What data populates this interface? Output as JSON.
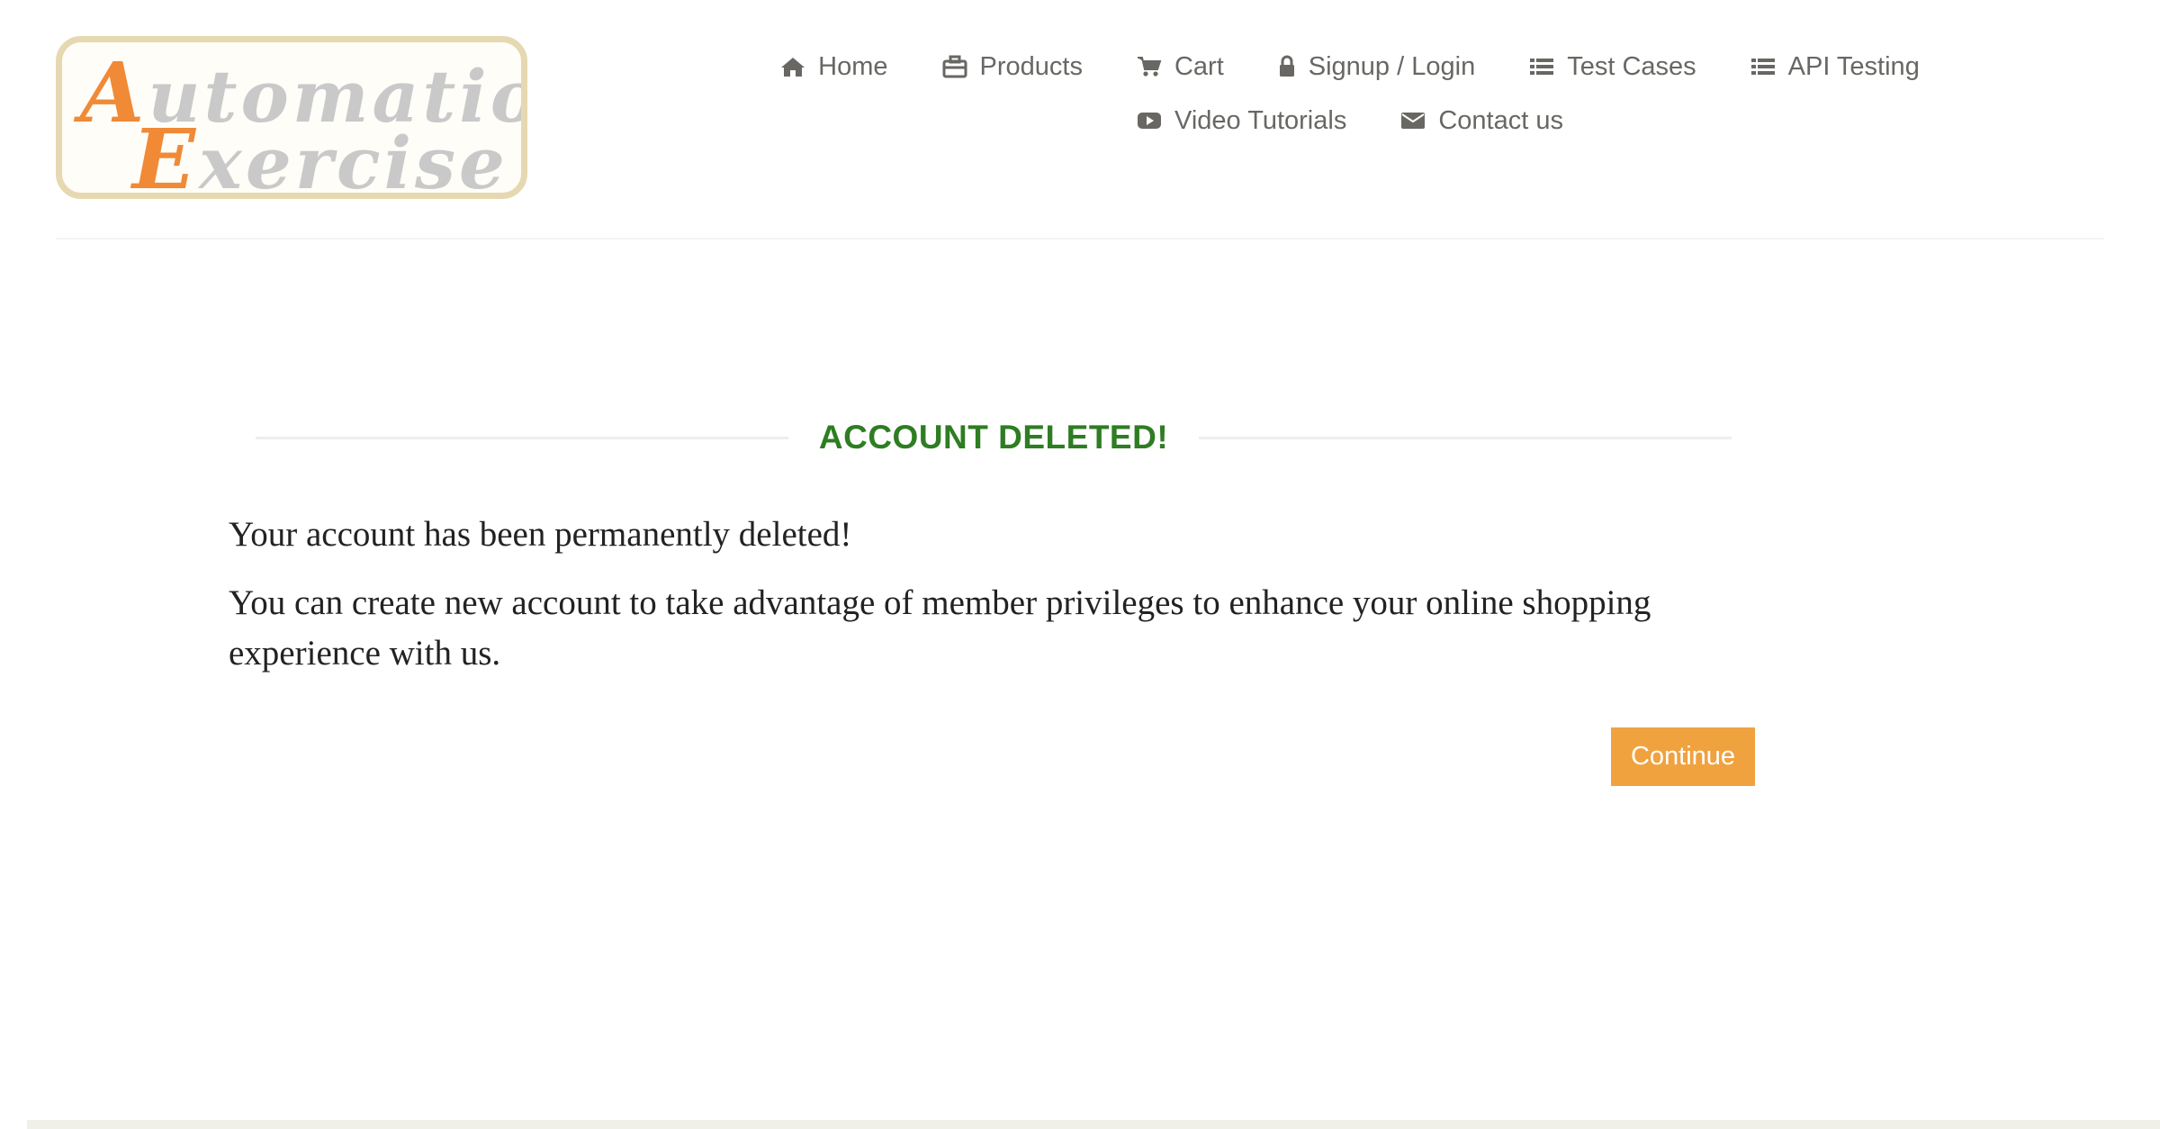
{
  "header": {
    "logo": {
      "line1_cap": "A",
      "line1_rest": "utomation",
      "line2_cap": "E",
      "line2_rest": "xercise"
    },
    "nav": [
      {
        "label": "Home",
        "icon": "home-icon"
      },
      {
        "label": "Products",
        "icon": "briefcase-icon"
      },
      {
        "label": "Cart",
        "icon": "cart-icon"
      },
      {
        "label": "Signup / Login",
        "icon": "lock-icon"
      },
      {
        "label": "Test Cases",
        "icon": "list-icon"
      },
      {
        "label": "API Testing",
        "icon": "list-icon"
      },
      {
        "label": "Video Tutorials",
        "icon": "youtube-play-icon"
      },
      {
        "label": "Contact us",
        "icon": "envelope-icon"
      }
    ]
  },
  "main": {
    "title": "ACCOUNT DELETED!",
    "message1": "Your account has been permanently deleted!",
    "message2": "You can create new account to take advantage of member privileges to enhance your online shopping experience with us.",
    "continue_label": "Continue"
  },
  "colors": {
    "title": "#2e7d22",
    "button": "#f0a23f",
    "nav_text": "#696763",
    "logo_accent": "#f08a36"
  }
}
